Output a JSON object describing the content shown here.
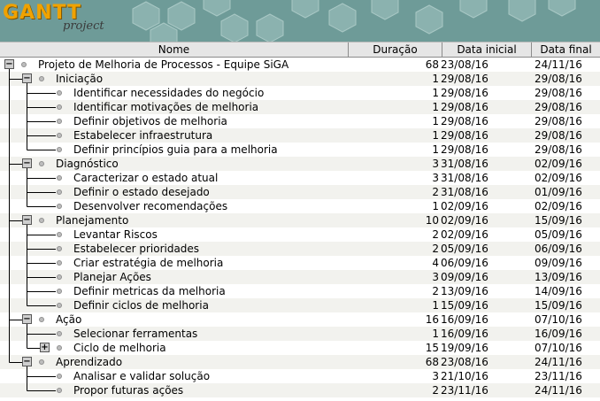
{
  "app": {
    "logo_main": "GANTT",
    "logo_sub": "project",
    "banner_color": "#6e9b98",
    "logo_color": "#f0a200"
  },
  "columns": {
    "name": "Nome",
    "duration": "Duração",
    "start": "Data inicial",
    "end": "Data final"
  },
  "tasks": [
    {
      "name": "Projeto de Melhoria de Processos - Equipe SiGA",
      "duration": "68",
      "start": "23/08/16",
      "end": "24/11/16",
      "level": 0,
      "toggle": "minus"
    },
    {
      "name": "Iniciação",
      "duration": "1",
      "start": "29/08/16",
      "end": "29/08/16",
      "level": 1,
      "toggle": "minus"
    },
    {
      "name": "Identificar necessidades do negócio",
      "duration": "1",
      "start": "29/08/16",
      "end": "29/08/16",
      "level": 2
    },
    {
      "name": "Identificar motivações de melhoria",
      "duration": "1",
      "start": "29/08/16",
      "end": "29/08/16",
      "level": 2
    },
    {
      "name": "Definir objetivos de melhoria",
      "duration": "1",
      "start": "29/08/16",
      "end": "29/08/16",
      "level": 2
    },
    {
      "name": "Estabelecer infraestrutura",
      "duration": "1",
      "start": "29/08/16",
      "end": "29/08/16",
      "level": 2
    },
    {
      "name": "Definir princípios guia para a melhoria",
      "duration": "1",
      "start": "29/08/16",
      "end": "29/08/16",
      "level": 2
    },
    {
      "name": "Diagnóstico",
      "duration": "3",
      "start": "31/08/16",
      "end": "02/09/16",
      "level": 1,
      "toggle": "minus"
    },
    {
      "name": "Caracterizar o estado atual",
      "duration": "3",
      "start": "31/08/16",
      "end": "02/09/16",
      "level": 2
    },
    {
      "name": "Definir o estado desejado",
      "duration": "2",
      "start": "31/08/16",
      "end": "01/09/16",
      "level": 2
    },
    {
      "name": "Desenvolver recomendações",
      "duration": "1",
      "start": "02/09/16",
      "end": "02/09/16",
      "level": 2
    },
    {
      "name": "Planejamento",
      "duration": "10",
      "start": "02/09/16",
      "end": "15/09/16",
      "level": 1,
      "toggle": "minus"
    },
    {
      "name": "Levantar Riscos",
      "duration": "2",
      "start": "02/09/16",
      "end": "05/09/16",
      "level": 2
    },
    {
      "name": "Estabelecer prioridades",
      "duration": "2",
      "start": "05/09/16",
      "end": "06/09/16",
      "level": 2
    },
    {
      "name": "Criar estratégia de melhoria",
      "duration": "4",
      "start": "06/09/16",
      "end": "09/09/16",
      "level": 2
    },
    {
      "name": "Planejar Ações",
      "duration": "3",
      "start": "09/09/16",
      "end": "13/09/16",
      "level": 2
    },
    {
      "name": "Definir metricas da melhoria",
      "duration": "2",
      "start": "13/09/16",
      "end": "14/09/16",
      "level": 2
    },
    {
      "name": "Definir ciclos de melhoria",
      "duration": "1",
      "start": "15/09/16",
      "end": "15/09/16",
      "level": 2
    },
    {
      "name": "Ação",
      "duration": "16",
      "start": "16/09/16",
      "end": "07/10/16",
      "level": 1,
      "toggle": "minus"
    },
    {
      "name": "Selecionar ferramentas",
      "duration": "1",
      "start": "16/09/16",
      "end": "16/09/16",
      "level": 2
    },
    {
      "name": "Ciclo de melhoria",
      "duration": "15",
      "start": "19/09/16",
      "end": "07/10/16",
      "level": 2,
      "toggle": "plus"
    },
    {
      "name": "Aprendizado",
      "duration": "68",
      "start": "23/08/16",
      "end": "24/11/16",
      "level": 1,
      "toggle": "minus"
    },
    {
      "name": "Analisar e validar solução",
      "duration": "3",
      "start": "21/10/16",
      "end": "23/11/16",
      "level": 2
    },
    {
      "name": "Propor futuras ações",
      "duration": "2",
      "start": "23/11/16",
      "end": "24/11/16",
      "level": 2
    }
  ]
}
